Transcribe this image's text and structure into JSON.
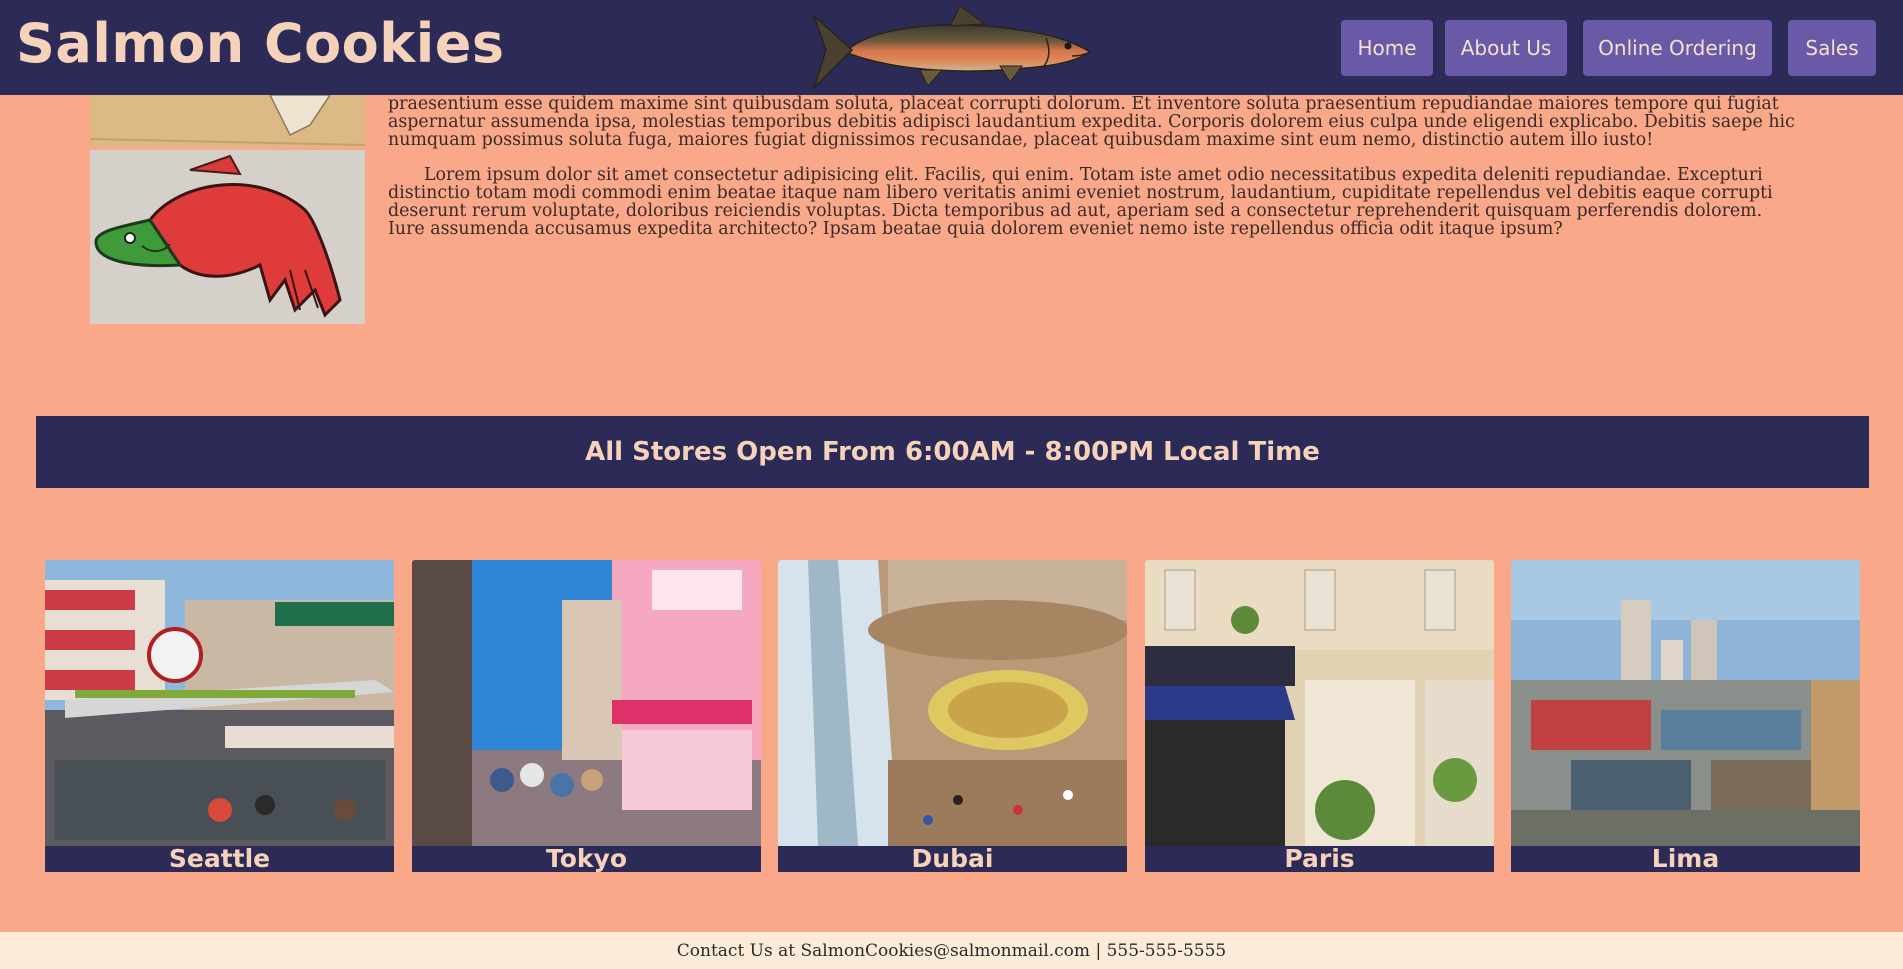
{
  "header": {
    "title": "Salmon Cookies",
    "logo_icon": "salmon-fish-icon",
    "nav": [
      {
        "label": "Home"
      },
      {
        "label": "About Us"
      },
      {
        "label": "Online Ordering"
      },
      {
        "label": "Sales"
      }
    ]
  },
  "about": {
    "paragraph1": "praesentium esse quidem maxime sint quibusdam soluta, placeat corrupti dolorum. Et inventore soluta praesentium repudiandae maiores tempore qui fugiat aspernatur assumenda ipsa, molestias temporibus debitis adipisci laudantium expedita. Corporis dolorem eius culpa unde eligendi explicabo. Debitis saepe hic numquam possimus soluta fuga, maiores fugiat dignissimos recusandae, placeat quibusdam maxime sint eum nemo, distinctio autem illo iusto!",
    "paragraph2": "Lorem ipsum dolor sit amet consectetur adipisicing elit. Facilis, qui enim. Totam iste amet odio necessitatibus expedita deleniti repudiandae. Excepturi distinctio totam modi commodi enim beatae itaque nam libero veritatis animi eveniet nostrum, laudantium, cupiditate repellendus vel debitis eaque corrupti deserunt rerum voluptate, doloribus reiciendis voluptas. Dicta temporibus ad aut, aperiam sed a consectetur reprehenderit quisquam perferendis dolorem. Iure assumenda accusamus expedita architecto? Ipsam beatae quia dolorem eveniet nemo iste repellendus officia odit itaque ipsum?"
  },
  "hours": {
    "text": "All Stores Open From 6:00AM - 8:00PM Local Time"
  },
  "stores": [
    {
      "name": "Seattle"
    },
    {
      "name": "Tokyo"
    },
    {
      "name": "Dubai"
    },
    {
      "name": "Paris"
    },
    {
      "name": "Lima"
    }
  ],
  "footer": {
    "contact": "Contact Us at SalmonCookies@salmonmail.com | 555-555-5555"
  },
  "colors": {
    "background": "#f9a98a",
    "navy": "#2c2a57",
    "button": "#6a59a6",
    "accent_text": "#f6d2ba",
    "footer_bg": "#fdebd9"
  }
}
